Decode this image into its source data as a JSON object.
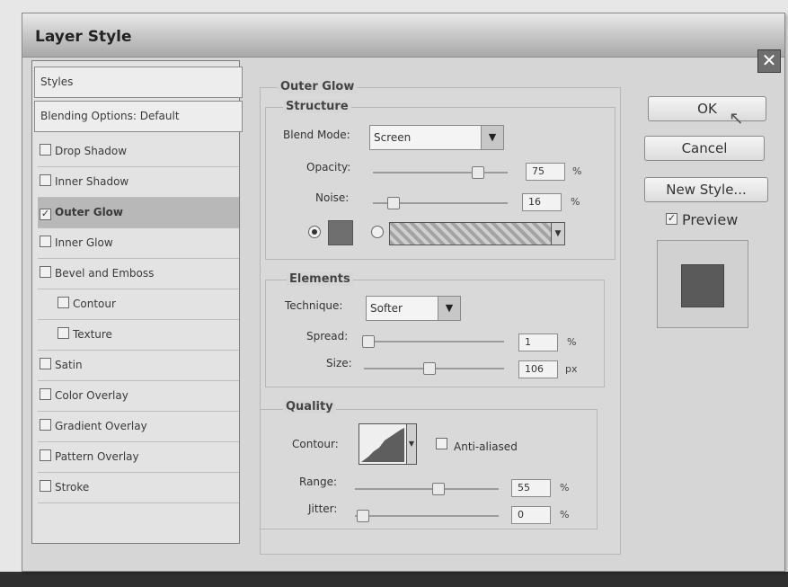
{
  "dialog": {
    "title": "Layer Style",
    "close_glyph": "✕"
  },
  "sidebar": {
    "items": [
      {
        "label": "Styles",
        "type": "header"
      },
      {
        "label": "Blending Options: Default",
        "type": "header"
      },
      {
        "label": "Drop Shadow",
        "checked": false
      },
      {
        "label": "Inner Shadow",
        "checked": false
      },
      {
        "label": "Outer Glow",
        "checked": true,
        "selected": true
      },
      {
        "label": "Inner Glow",
        "checked": false
      },
      {
        "label": "Bevel and Emboss",
        "checked": false
      },
      {
        "label": "Contour",
        "checked": false,
        "indent": true
      },
      {
        "label": "Texture",
        "checked": false,
        "indent": true
      },
      {
        "label": "Satin",
        "checked": false
      },
      {
        "label": "Color Overlay",
        "checked": false
      },
      {
        "label": "Gradient Overlay",
        "checked": false
      },
      {
        "label": "Pattern Overlay",
        "checked": false
      },
      {
        "label": "Stroke",
        "checked": false
      }
    ]
  },
  "outer_glow": {
    "title": "Outer Glow",
    "structure": {
      "title": "Structure",
      "blend_mode_label": "Blend Mode:",
      "blend_mode_value": "Screen",
      "opacity_label": "Opacity:",
      "opacity_value": "75",
      "opacity_unit": "%",
      "noise_label": "Noise:",
      "noise_value": "16",
      "noise_unit": "%",
      "glow_color": "#6f6f6f"
    },
    "elements": {
      "title": "Elements",
      "technique_label": "Technique:",
      "technique_value": "Softer",
      "spread_label": "Spread:",
      "spread_value": "1",
      "spread_unit": "%",
      "size_label": "Size:",
      "size_value": "106",
      "size_unit": "px"
    },
    "quality": {
      "title": "Quality",
      "contour_label": "Contour:",
      "anti_aliased_label": "Anti-aliased",
      "range_label": "Range:",
      "range_value": "55",
      "range_unit": "%",
      "jitter_label": "Jitter:",
      "jitter_value": "0",
      "jitter_unit": "%"
    }
  },
  "buttons": {
    "ok": "OK",
    "cancel": "Cancel",
    "new_style": "New Style..."
  },
  "preview": {
    "label": "Preview",
    "checked": true,
    "swatch_color": "#5a5a5a"
  }
}
